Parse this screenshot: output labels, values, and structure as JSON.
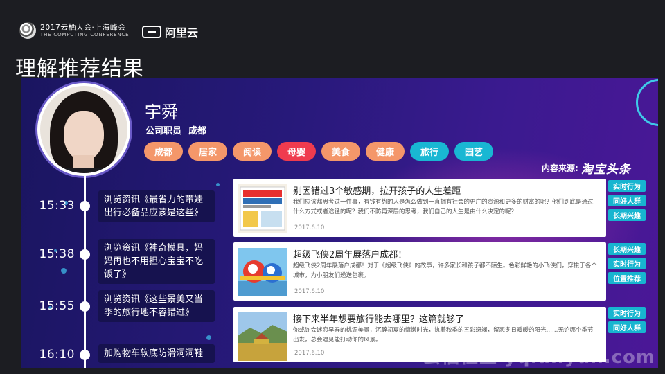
{
  "header": {
    "event_line1": "2017云栖大会·上海峰会",
    "event_line2": "THE COMPUTING CONFERENCE",
    "brand": "阿里云",
    "title": "理解推荐结果"
  },
  "profile": {
    "name": "宇舜",
    "occupation": "公司职员",
    "city": "成都"
  },
  "tags": [
    {
      "label": "成都",
      "color": "#f4976a"
    },
    {
      "label": "居家",
      "color": "#f4976a"
    },
    {
      "label": "阅读",
      "color": "#f4976a"
    },
    {
      "label": "母婴",
      "color": "#ef3b4e"
    },
    {
      "label": "美食",
      "color": "#f4976a"
    },
    {
      "label": "健康",
      "color": "#f4976a"
    },
    {
      "label": "旅行",
      "color": "#19b7d3"
    },
    {
      "label": "园艺",
      "color": "#19b7d3"
    }
  ],
  "content_source": {
    "label": "内容来源:",
    "brand": "淘宝头条"
  },
  "timeline": [
    {
      "time": "15:33",
      "action": "浏览资讯《最省力的带娃出行必备品应该是这些》"
    },
    {
      "time": "15:38",
      "action": "浏览资讯《神奇模具，妈妈再也不用担心宝宝不吃饭了》"
    },
    {
      "time": "15:55",
      "action": "浏览资讯《这些景美又当季的旅行地不容错过》"
    },
    {
      "time": "16:10",
      "action": "加购物车软底防滑洞洞鞋"
    }
  ],
  "cards": [
    {
      "title": "别因错过3个敏感期，拉开孩子的人生差距",
      "desc": "我们应该都思考过一件事，有钱有势的人是怎么做到一直拥有社会的更广的资源和更多的财富的呢？他们到底是通过什么方式或者途径的呢？我们不防再深层的思考，我们自己的人生是由什么决定的呢？",
      "date": "2017.6.10",
      "image": "book-cover",
      "badges": [
        "实时行为",
        "同好人群",
        "长期兴趣"
      ]
    },
    {
      "title": "超级飞侠2周年展落户成都！",
      "desc": "超级飞侠2周年展落户成都！对于《超级飞侠》的故事，许多家长和孩子都不陌生。色彩鲜艳的小飞侠们，穿梭于各个城市，为小朋友们递送包裹。",
      "date": "2017.6.10",
      "image": "cartoon-planes",
      "badges": [
        "长期兴趣",
        "实时行为",
        "位置推荐"
      ]
    },
    {
      "title": "接下来半年想要旅行能去哪里？这篇就够了",
      "desc": "你或许会迷恋早春的桃源美景，沉醉初夏的慵懒时光，执着秋季的五彩斑斓，留恋冬日暖暖的阳光……无论哪个季节出发，总会遇见能打动你的风景。",
      "date": "2017.6.10",
      "image": "landscape-photo",
      "badges": [
        "实时行为",
        "同好人群"
      ]
    }
  ],
  "watermark": "云栖社区 yq.aliyun.com"
}
